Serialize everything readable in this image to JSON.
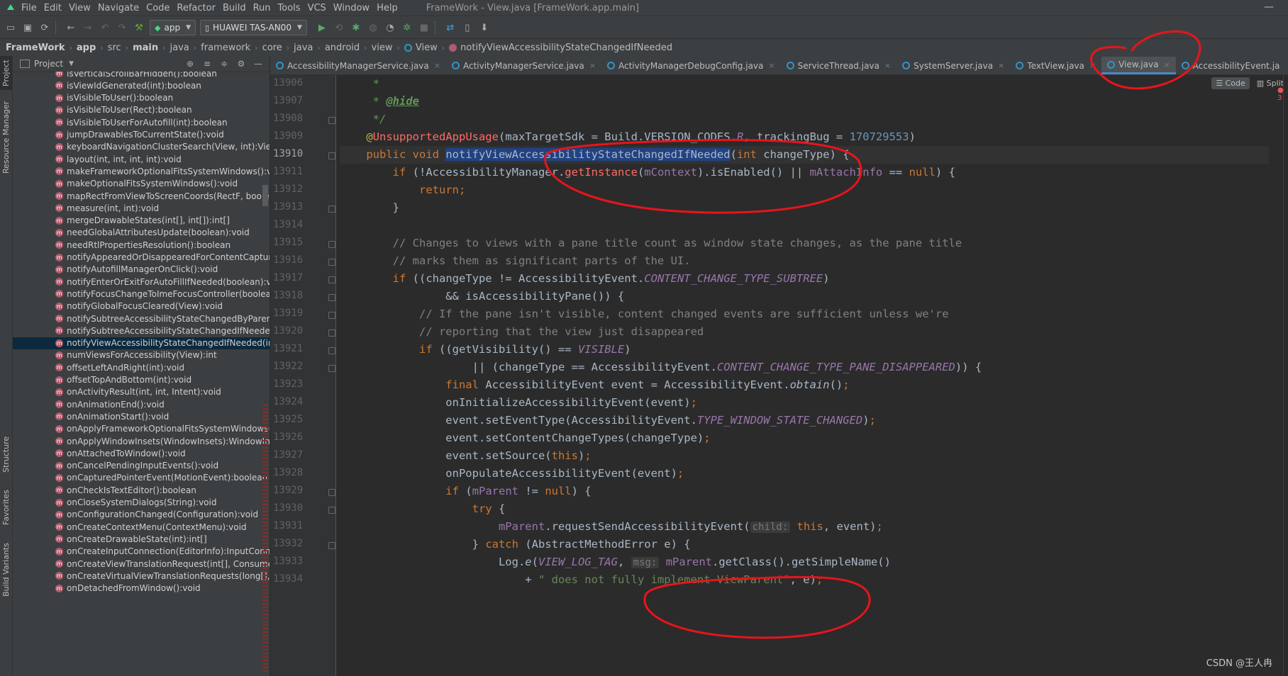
{
  "window": {
    "title": "FrameWork - View.java [FrameWork.app.main]",
    "controls": "—"
  },
  "menu": [
    "File",
    "Edit",
    "View",
    "Navigate",
    "Code",
    "Refactor",
    "Build",
    "Run",
    "Tools",
    "VCS",
    "Window",
    "Help"
  ],
  "toolbar": {
    "run_config": "app",
    "device": "HUAWEI TAS-AN00"
  },
  "breadcrumbs": [
    "FrameWork",
    "app",
    "src",
    "main",
    "java",
    "framework",
    "core",
    "java",
    "android",
    "view",
    "View",
    "notifyViewAccessibilityStateChangedIfNeeded"
  ],
  "left_strip": {
    "project": "Project",
    "resource_manager": "Resource Manager",
    "structure": "Structure",
    "favorites": "Favorites",
    "build_variants": "Build Variants"
  },
  "project_panel": {
    "title": "Project"
  },
  "methods": [
    "isVerticalScrollBarHidden():boolean",
    "isViewIdGenerated(int):boolean",
    "isVisibleToUser():boolean",
    "isVisibleToUser(Rect):boolean",
    "isVisibleToUserForAutofill(int):boolean",
    "jumpDrawablesToCurrentState():void",
    "keyboardNavigationClusterSearch(View, int):View",
    "layout(int, int, int, int):void",
    "makeFrameworkOptionalFitsSystemWindows():void",
    "makeOptionalFitsSystemWindows():void",
    "mapRectFromViewToScreenCoords(RectF, boolean):void",
    "measure(int, int):void",
    "mergeDrawableStates(int[], int[]):int[]",
    "needGlobalAttributesUpdate(boolean):void",
    "needRtlPropertiesResolution():boolean",
    "notifyAppearedOrDisappearedForContentCaptureIfNeeded",
    "notifyAutofillManagerOnClick():void",
    "notifyEnterOrExitForAutoFillIfNeeded(boolean):void",
    "notifyFocusChangeToImeFocusController(boolean):void",
    "notifyGlobalFocusCleared(View):void",
    "notifySubtreeAccessibilityStateChangedByParentIfNeeded",
    "notifySubtreeAccessibilityStateChangedIfNeeded():void",
    "notifyViewAccessibilityStateChangedIfNeeded(int):void",
    "numViewsForAccessibility(View):int",
    "offsetLeftAndRight(int):void",
    "offsetTopAndBottom(int):void",
    "onActivityResult(int, int, Intent):void",
    "onAnimationEnd():void",
    "onAnimationStart():void",
    "onApplyFrameworkOptionalFitsSystemWindows(Window",
    "onApplyWindowInsets(WindowInsets):WindowInsets",
    "onAttachedToWindow():void",
    "onCancelPendingInputEvents():void",
    "onCapturedPointerEvent(MotionEvent):boolean",
    "onCheckIsTextEditor():boolean",
    "onCloseSystemDialogs(String):void",
    "onConfigurationChanged(Configuration):void",
    "onCreateContextMenu(ContextMenu):void",
    "onCreateDrawableState(int):int[]",
    "onCreateInputConnection(EditorInfo):InputConnection",
    "onCreateViewTranslationRequest(int[], Consumer<View",
    "onCreateVirtualViewTranslationRequests(long[], int[], Con",
    "onDetachedFromWindow():void"
  ],
  "selected_method_index": 22,
  "tabs": [
    {
      "label": "AccessibilityManagerService.java",
      "active": false
    },
    {
      "label": "ActivityManagerService.java",
      "active": false
    },
    {
      "label": "ActivityManagerDebugConfig.java",
      "active": false
    },
    {
      "label": "ServiceThread.java",
      "active": false
    },
    {
      "label": "SystemServer.java",
      "active": false
    },
    {
      "label": "TextView.java",
      "active": false
    },
    {
      "label": "View.java",
      "active": true
    },
    {
      "label": "AccessibilityEvent.ja",
      "active": false
    }
  ],
  "editor_tools": {
    "code": "Code",
    "split": "Split",
    "problems": "3"
  },
  "line_numbers": [
    "13906",
    "13907",
    "13908",
    "13909",
    "13910",
    "13911",
    "13912",
    "13913",
    "13914",
    "13915",
    "13916",
    "13917",
    "13918",
    "13919",
    "13920",
    "13921",
    "13922",
    "13923",
    "13924",
    "13925",
    "13926",
    "13927",
    "13928",
    "13929",
    "13930",
    "13931",
    "13932",
    "13933",
    "13934"
  ],
  "current_line": "13910",
  "code": {
    "l13906": "     *",
    "l13907_pre": "     * ",
    "l13907_tag": "@hide",
    "l13908": "     */",
    "l13909_at": "    @",
    "l13909_ann": "UnsupportedAppUsage",
    "l13909_a": "(maxTargetSdk = Build.VERSION_CODES.",
    "l13909_r": "R",
    "l13909_b": ", trackingBug = ",
    "l13909_num": "170729553",
    "l13909_c": ")",
    "l13910_kw": "    public void ",
    "l13910_name": "notifyViewAccessibilityStateChangedIfNeeded",
    "l13910_p": "(",
    "l13910_int": "int",
    "l13910_rest": " changeType) {",
    "l13911_kw": "        if ",
    "l13911_a": "(!AccessibilityManager.",
    "l13911_gi": "getInstance",
    "l13911_b": "(",
    "l13911_ctx": "mContext",
    "l13911_c": ").isEnabled() || ",
    "l13911_ai": "mAttachInfo",
    "l13911_d": " == ",
    "l13911_null": "null",
    "l13911_e": ") {",
    "l13912_kw": "            return",
    "l13912_semi": ";",
    "l13913": "        }",
    "l13915": "        // Changes to views with a pane title count as window state changes, as the pane title",
    "l13916": "        // marks them as significant parts of the UI.",
    "l13917_kw": "        if ",
    "l13917_a": "((changeType != AccessibilityEvent.",
    "l13917_s": "CONTENT_CHANGE_TYPE_SUBTREE",
    "l13917_b": ")",
    "l13918": "                && isAccessibilityPane()) {",
    "l13919": "            // If the pane isn't visible, content changed events are sufficient unless we're",
    "l13920": "            // reporting that the view just disappeared",
    "l13921_kw": "            if ",
    "l13921_a": "((getVisibility() == ",
    "l13921_s": "VISIBLE",
    "l13921_b": ")",
    "l13922_a": "                    || (changeType == AccessibilityEvent.",
    "l13922_s": "CONTENT_CHANGE_TYPE_PANE_DISAPPEARED",
    "l13922_b": ")) {",
    "l13923_kw": "                final ",
    "l13923_a": "AccessibilityEvent event = AccessibilityEvent.",
    "l13923_m": "obtain",
    "l13923_b": "()",
    "l13923_semi": ";",
    "l13924_a": "                onInitializeAccessibilityEvent(event)",
    "l13924_semi": ";",
    "l13925_a": "                event.setEventType(AccessibilityEvent.",
    "l13925_s": "TYPE_WINDOW_STATE_CHANGED",
    "l13925_b": ")",
    "l13925_semi": ";",
    "l13926_a": "                event.setContentChangeTypes(changeType)",
    "l13926_semi": ";",
    "l13927_a": "                event.setSource(",
    "l13927_kw": "this",
    "l13927_b": ")",
    "l13927_semi": ";",
    "l13928_a": "                onPopulateAccessibilityEvent(event)",
    "l13928_semi": ";",
    "l13929_kw": "                if ",
    "l13929_a": "(",
    "l13929_f": "mParent",
    "l13929_b": " != ",
    "l13929_null": "null",
    "l13929_c": ") {",
    "l13930_kw": "                    try ",
    "l13930_a": "{",
    "l13931_f": "                        mParent",
    "l13931_a": ".requestSendAccessibilityEvent(",
    "l13931_hint": "child:",
    "l13931_kw": " this",
    "l13931_b": ", event)",
    "l13931_semi": ";",
    "l13932_a": "                    } ",
    "l13932_kw": "catch ",
    "l13932_b": "(AbstractMethodError e) {",
    "l13933_a": "                        Log.",
    "l13933_m": "e",
    "l13933_b": "(",
    "l13933_s": "VIEW_LOG_TAG",
    "l13933_c": ", ",
    "l13933_hint": "msg:",
    "l13933_f": " mParent",
    "l13933_d": ".getClass().getSimpleName()",
    "l13934_a": "                            + ",
    "l13934_str": "\" does not fully implement ViewParent\"",
    "l13934_b": ", e)",
    "l13934_semi": ";"
  },
  "watermark": "CSDN @王人冉",
  "colors": {
    "annotation_circle": "#e8141c",
    "selection": "#214283",
    "tab_underline": "#4a88c7"
  }
}
